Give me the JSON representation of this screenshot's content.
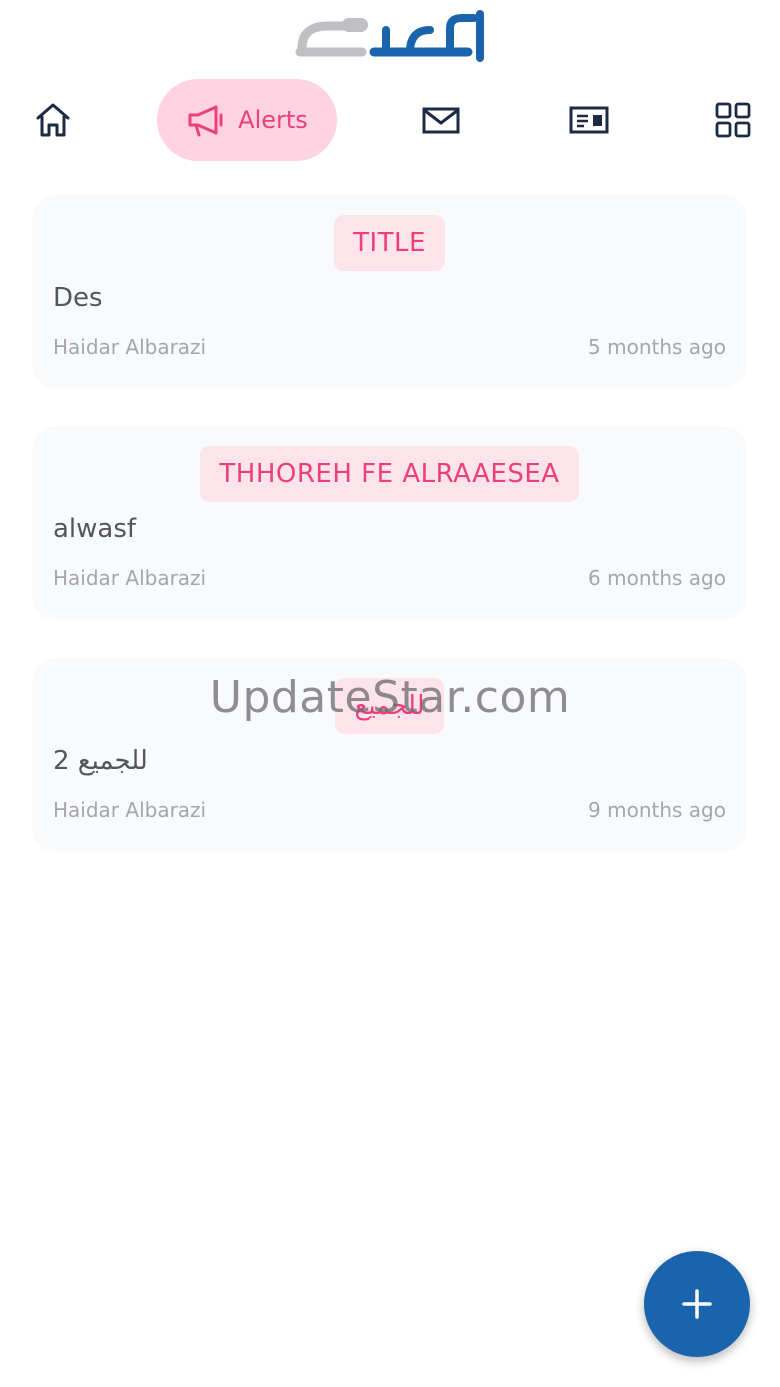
{
  "app": {
    "logo_text": "اكتفاء"
  },
  "nav": {
    "items": [
      {
        "id": "home",
        "icon": "home-icon"
      },
      {
        "id": "alerts",
        "icon": "megaphone-icon",
        "label": "Alerts",
        "active": true
      },
      {
        "id": "messages",
        "icon": "mail-icon"
      },
      {
        "id": "card",
        "icon": "id-card-icon"
      },
      {
        "id": "apps",
        "icon": "grid-icon"
      }
    ],
    "active_color": "#ec3f7c",
    "active_bg": "#ffd3e1"
  },
  "alerts": [
    {
      "title": "TITLE",
      "description": "Des",
      "author": "Haidar Albarazi",
      "time": "5 months ago"
    },
    {
      "title": "THHOREH FE ALRAAESEA",
      "description": "alwasf",
      "author": "Haidar Albarazi",
      "time": "6 months ago"
    },
    {
      "title": "للجميع",
      "description": "للجميع 2",
      "author": "Haidar Albarazi",
      "time": "9 months ago"
    }
  ],
  "watermark": "UpdateStar.com",
  "fab": {
    "icon": "plus-icon",
    "color": "#1a64ad"
  }
}
